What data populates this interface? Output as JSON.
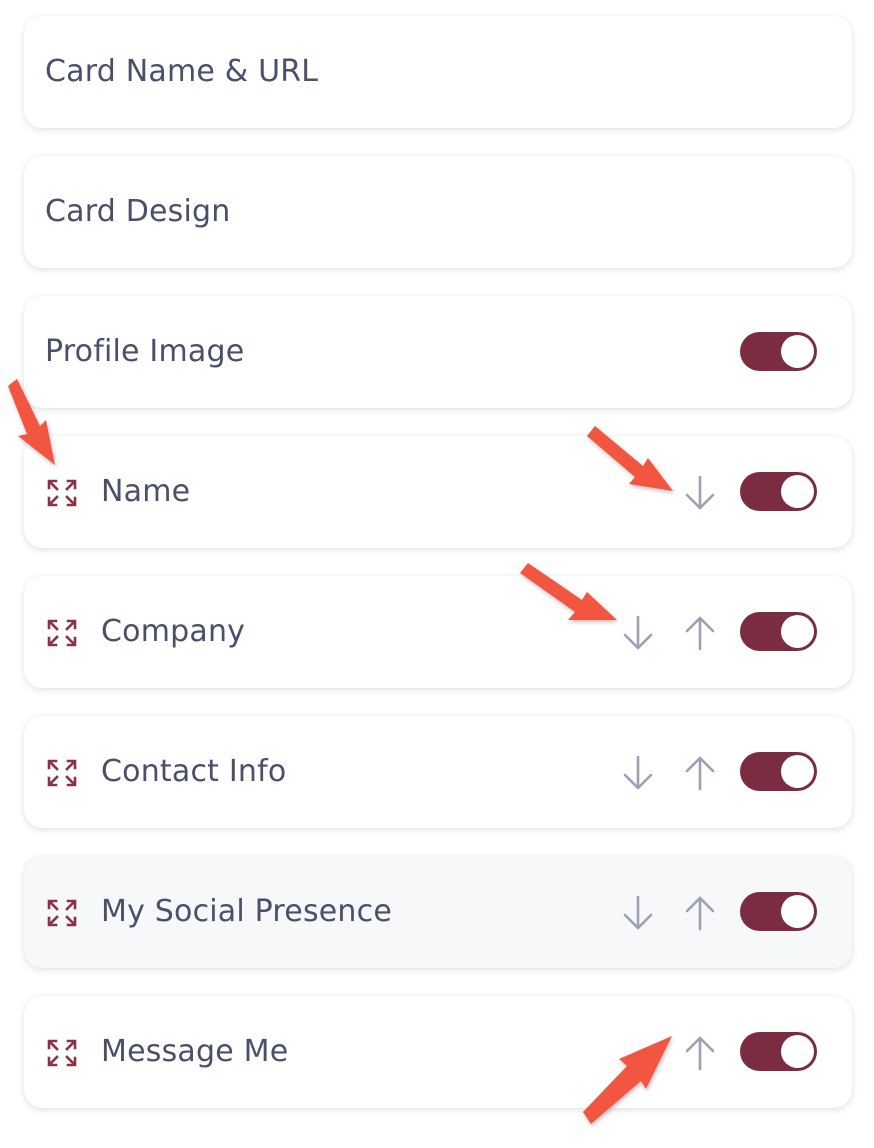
{
  "colors": {
    "toggle_on": "#7b2c40",
    "drag_icon": "#8b3344",
    "arrow_icon": "#9ba1b3",
    "label_text": "#4a4f6b",
    "callout_arrow": "#f2573f"
  },
  "sections": [
    {
      "label": "Card Name & URL",
      "draggable": false,
      "toggle_on": null
    },
    {
      "label": "Card Design",
      "draggable": false,
      "toggle_on": null
    },
    {
      "label": "Profile Image",
      "draggable": false,
      "toggle_on": true
    },
    {
      "label": "Name",
      "draggable": true,
      "move_down": true,
      "move_up": false,
      "toggle_on": true,
      "icon": "expand-icon"
    },
    {
      "label": "Company",
      "draggable": true,
      "move_down": true,
      "move_up": true,
      "toggle_on": true,
      "icon": "expand-icon"
    },
    {
      "label": "Contact Info",
      "draggable": true,
      "move_down": true,
      "move_up": true,
      "toggle_on": true,
      "icon": "expand-icon"
    },
    {
      "label": "My Social Presence",
      "draggable": true,
      "move_down": true,
      "move_up": true,
      "toggle_on": true,
      "icon": "expand-icon"
    },
    {
      "label": "Message Me",
      "draggable": true,
      "move_down": false,
      "move_up": true,
      "toggle_on": true,
      "icon": "expand-icon"
    }
  ],
  "icons": {
    "drag": "expand-icon",
    "down": "arrow-down-icon",
    "up": "arrow-up-icon",
    "callout": "annotation-arrow"
  }
}
